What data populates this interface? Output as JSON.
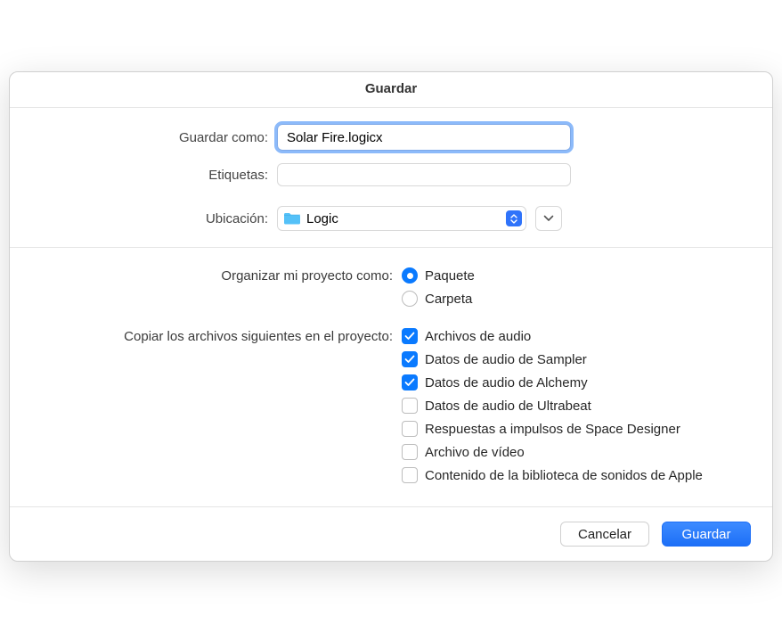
{
  "title": "Guardar",
  "fields": {
    "save_as_label": "Guardar como:",
    "save_as_value": "Solar Fire.logicx",
    "tags_label": "Etiquetas:",
    "location_label": "Ubicación:",
    "location_value": "Logic"
  },
  "organize": {
    "label": "Organizar mi proyecto como:",
    "options": [
      {
        "label": "Paquete",
        "checked": true
      },
      {
        "label": "Carpeta",
        "checked": false
      }
    ]
  },
  "copy": {
    "label": "Copiar los archivos siguientes en el proyecto:",
    "items": [
      {
        "label": "Archivos de audio",
        "checked": true
      },
      {
        "label": "Datos de audio de Sampler",
        "checked": true
      },
      {
        "label": "Datos de audio de Alchemy",
        "checked": true
      },
      {
        "label": "Datos de audio de Ultrabeat",
        "checked": false
      },
      {
        "label": "Respuestas a impulsos de Space Designer",
        "checked": false
      },
      {
        "label": "Archivo de vídeo",
        "checked": false
      },
      {
        "label": "Contenido de la biblioteca de sonidos de Apple",
        "checked": false
      }
    ]
  },
  "buttons": {
    "cancel": "Cancelar",
    "save": "Guardar"
  }
}
